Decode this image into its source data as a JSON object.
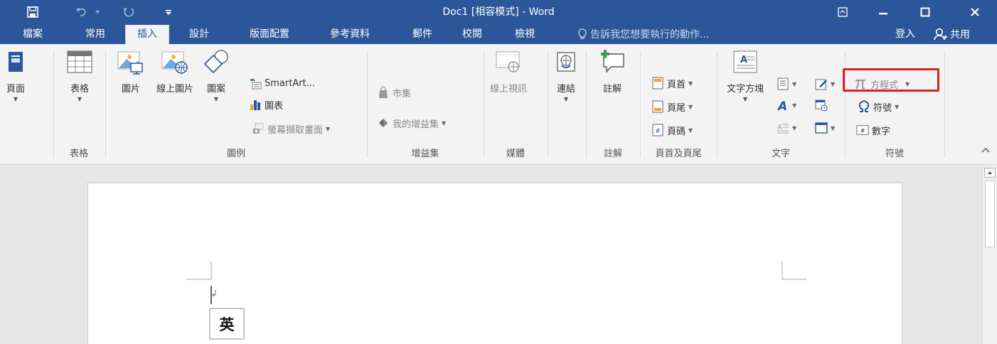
{
  "window": {
    "title": "Doc1 [相容模式] - Word"
  },
  "tabs": [
    "檔案",
    "常用",
    "插入",
    "設計",
    "版面配置",
    "參考資料",
    "郵件",
    "校閱",
    "檢視"
  ],
  "active_tab": "插入",
  "tellme": {
    "placeholder": "告訴我您想要執行的動作..."
  },
  "account": {
    "signin": "登入",
    "share": "共用"
  },
  "ribbon": {
    "pages": {
      "cover": "頁面",
      "group": ""
    },
    "tables": {
      "table": "表格",
      "group": "表格"
    },
    "illustrations": {
      "pictures": "圖片",
      "online_pictures": "線上圖片",
      "shapes": "圖案",
      "smartart": "SmartArt...",
      "chart": "圖表",
      "screenshot": "螢幕擷取畫面",
      "group": "圖例"
    },
    "addins": {
      "store": "市集",
      "my_addins": "我的增益集",
      "group": "增益集"
    },
    "media": {
      "online_video": "線上視訊",
      "group": "媒體"
    },
    "links": {
      "link": "連結",
      "group": ""
    },
    "comments": {
      "comment": "註解",
      "group": "註解"
    },
    "header_footer": {
      "header": "頁首",
      "footer": "頁尾",
      "page_number": "頁碼",
      "group": "頁首及頁尾"
    },
    "text": {
      "text_box": "文字方塊",
      "group": "文字"
    },
    "symbols": {
      "equation": "方程式",
      "symbol": "符號",
      "number": "數字",
      "group": "符號"
    }
  },
  "document": {
    "ime_indicator": "英"
  },
  "colors": {
    "title_bar": "#2b579a",
    "ribbon_bg": "#f3f3f3",
    "highlight": "#e02020"
  }
}
